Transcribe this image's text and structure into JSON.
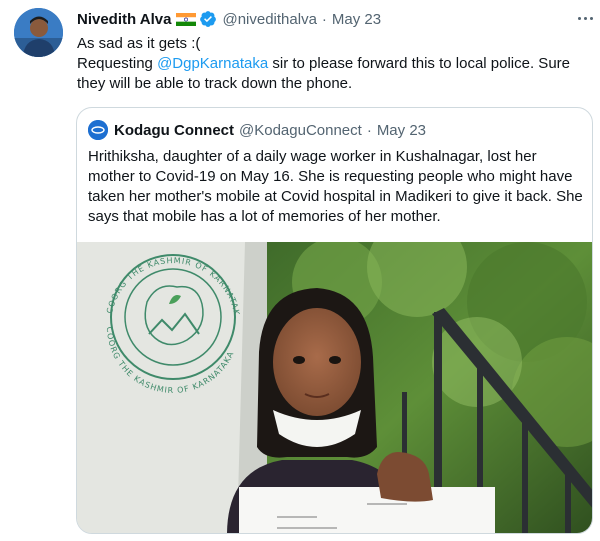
{
  "tweet": {
    "author_name": "Nivedith Alva",
    "handle": "@nivedithalva",
    "separator": "·",
    "date": "May 23",
    "line1": "As sad as it gets :(",
    "line2_before": "Requesting ",
    "mention": "@DgpKarnataka",
    "line2_after": " sir to please forward this to local police. Sure they will be able to track down the phone."
  },
  "quote": {
    "author_name": "Kodagu Connect",
    "handle": "@KodaguConnect",
    "separator": "·",
    "date": "May 23",
    "text": "Hrithiksha, daughter of a daily wage worker in Kushalnagar, lost her mother to Covid-19 on May 16. She is requesting people who might have taken her mother's mobile at Covid hospital in Madikeri to give it back. She says that mobile has a lot of memories of her mother.",
    "photo": {
      "emblem_top_text": "COORG THE KASHMIR OF KARNATAKA",
      "emblem_bottom_text": "COORG THE KASHMIR OF KARNATAKA"
    }
  },
  "icons": {
    "flag": "india-flag-icon",
    "verified": "verified-badge-icon",
    "more": "more-options-icon"
  },
  "colors": {
    "link": "#1d9bf0",
    "verified": "#1d9bf0",
    "secondary_text": "#536471",
    "border": "#cfd9de"
  }
}
